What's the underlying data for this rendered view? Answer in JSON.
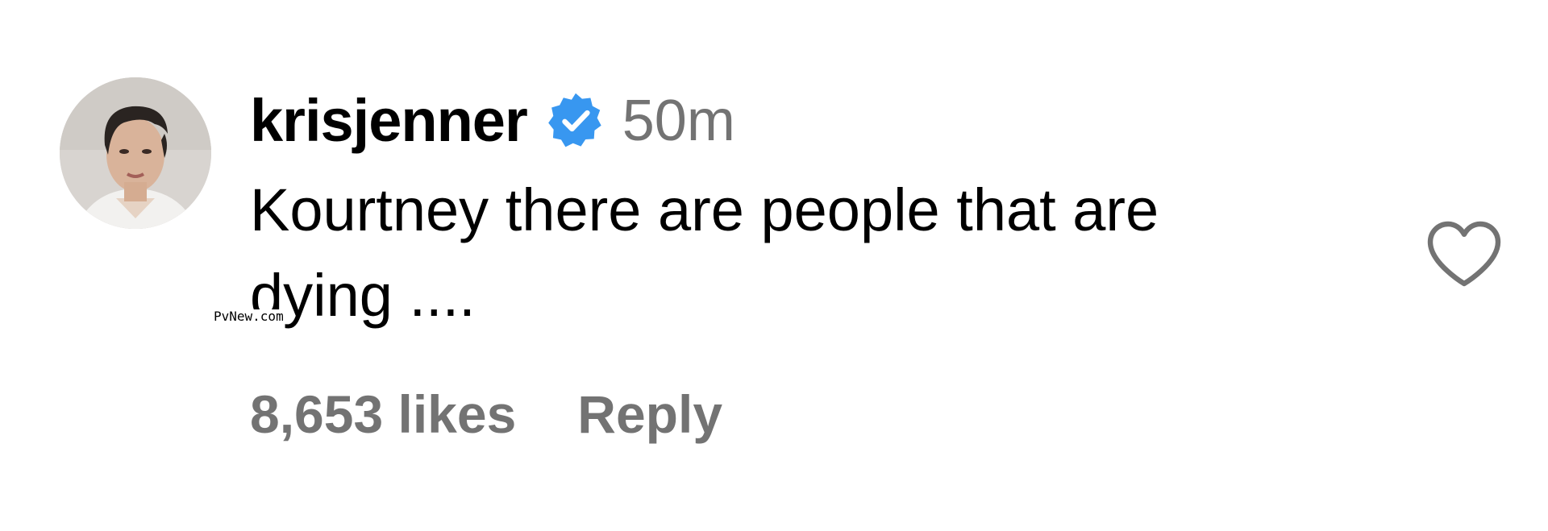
{
  "comment": {
    "username": "krisjenner",
    "verified_icon": "verified-badge-icon",
    "verified_color": "#3897f0",
    "timestamp": "50m",
    "text": "Kourtney there are people that are\ndying ....",
    "likes": "8,653 likes",
    "reply_label": "Reply",
    "like_icon": "heart-outline-icon",
    "secondary_text_color": "#737373"
  },
  "watermark": {
    "text": "PvNew.com"
  }
}
